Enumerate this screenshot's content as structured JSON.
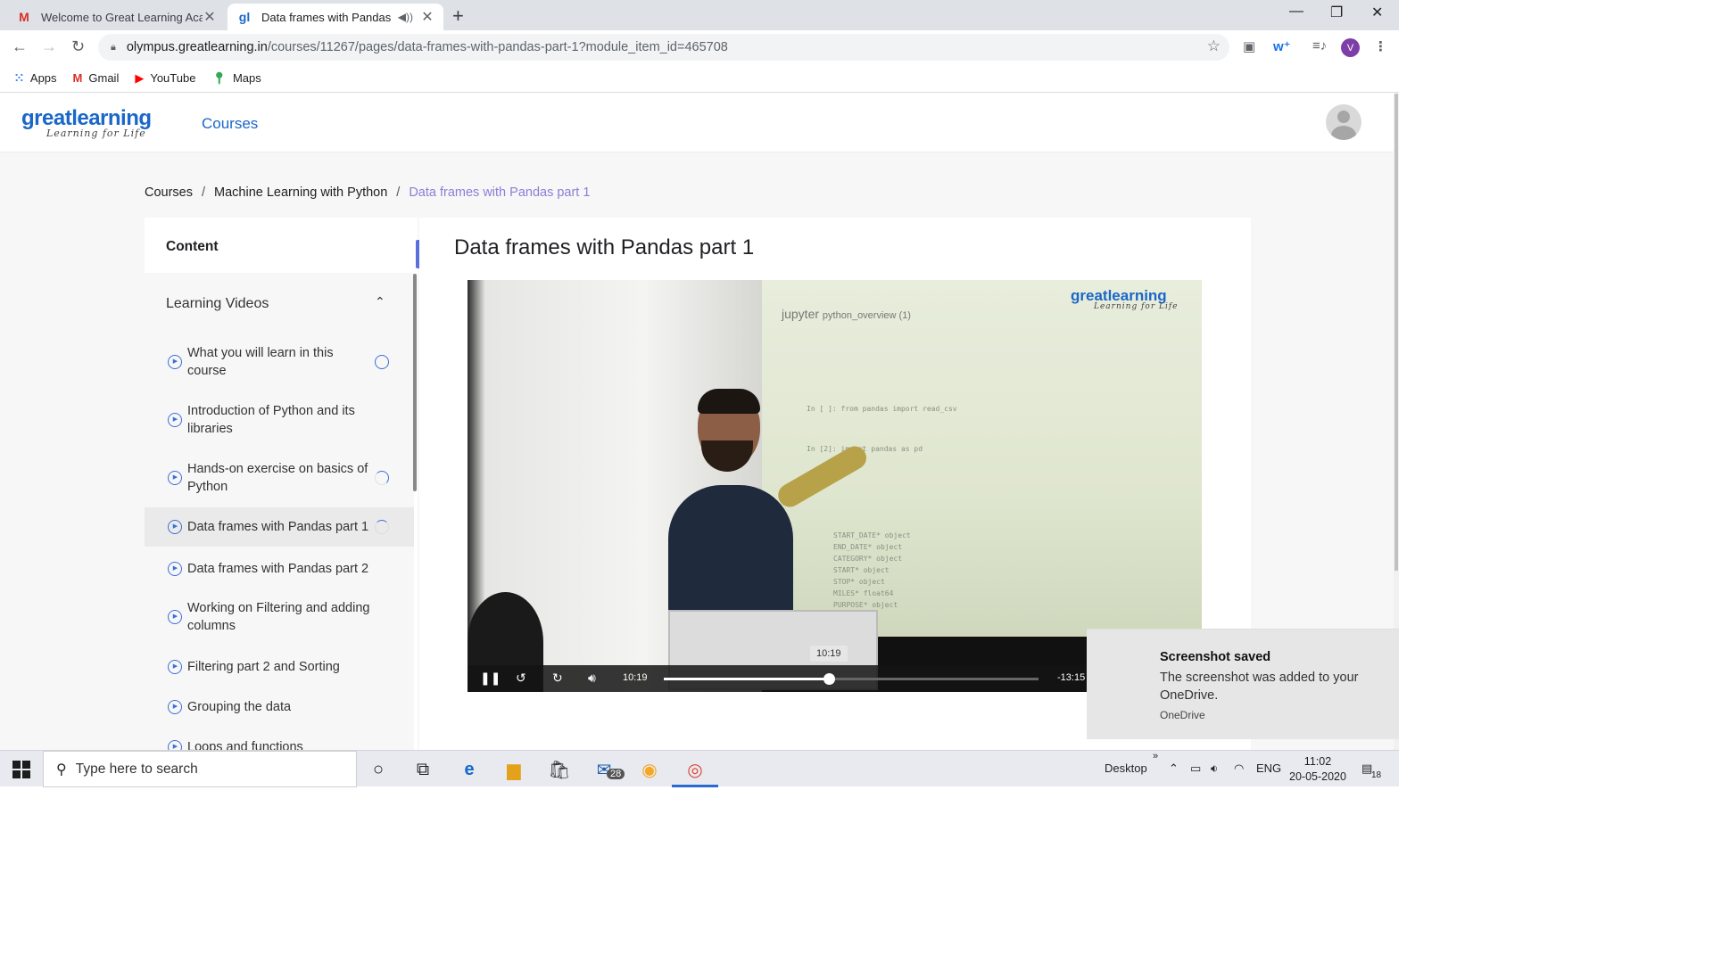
{
  "browser": {
    "tabs": [
      {
        "title": "Welcome to Great Learning Acad",
        "favicon": "M",
        "active": false
      },
      {
        "title": "Data frames with Pandas par",
        "favicon": "gl",
        "active": true
      }
    ],
    "new_tab": "+",
    "address": {
      "host": "olympus.greatlearning.in",
      "path": "/courses/11267/pages/data-frames-with-pandas-part-1?module_item_id=465708"
    },
    "profile_initial": "V",
    "bookmarks": [
      {
        "label": "Apps",
        "icon": "apps-grid-icon"
      },
      {
        "label": "Gmail",
        "icon": "gmail-icon"
      },
      {
        "label": "YouTube",
        "icon": "youtube-icon"
      },
      {
        "label": "Maps",
        "icon": "maps-icon"
      }
    ]
  },
  "site": {
    "logo_word": "greatlearning",
    "logo_tag": "Learning for Life",
    "nav_courses": "Courses"
  },
  "breadcrumb": {
    "items": [
      "Courses",
      "Machine Learning with Python",
      "Data frames with Pandas part 1"
    ],
    "sep": "/"
  },
  "sidebar": {
    "heading": "Content",
    "section": "Learning Videos",
    "items": [
      {
        "label": "What you will learn in this course",
        "status": "empty"
      },
      {
        "label": "Introduction of Python and its libraries",
        "status": "none"
      },
      {
        "label": "Hands-on exercise on basics of Python",
        "status": "partial"
      },
      {
        "label": "Data frames with Pandas part 1",
        "status": "started",
        "active": true
      },
      {
        "label": "Data frames with Pandas part 2",
        "status": "none"
      },
      {
        "label": "Working on Filtering and adding columns",
        "status": "none"
      },
      {
        "label": "Filtering part 2 and Sorting",
        "status": "none"
      },
      {
        "label": "Grouping the data",
        "status": "none"
      },
      {
        "label": "Loops and functions",
        "status": "none"
      }
    ]
  },
  "main": {
    "title": "Data frames with Pandas part 1",
    "video": {
      "watermark_word": "greatlearning",
      "watermark_tag": "Learning for Life",
      "jupyter_label": "jupyter",
      "notebook_name": "python_overview (1)",
      "elapsed": "10:19",
      "remaining": "-13:15",
      "tooltip": "10:19",
      "progress": 0.44
    }
  },
  "toast": {
    "title": "Screenshot saved",
    "body": "The screenshot was added to your OneDrive.",
    "source": "OneDrive"
  },
  "taskbar": {
    "search_placeholder": "Type here to search",
    "mail_badge": "28",
    "desktop_label": "Desktop",
    "language": "ENG",
    "time": "11:02",
    "date": "20-05-2020",
    "notification_count": "18"
  }
}
